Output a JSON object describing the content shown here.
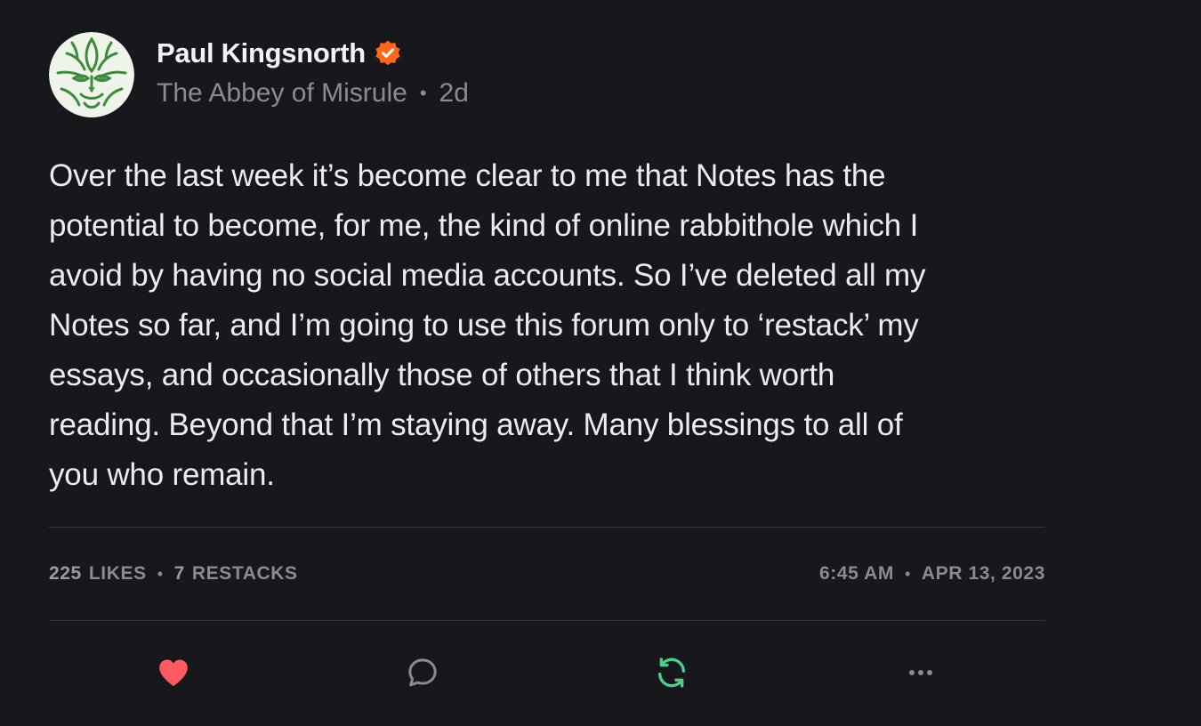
{
  "author": {
    "name": "Paul Kingsnorth",
    "publication": "The Abbey of Misrule",
    "age": "2d",
    "separator": "•"
  },
  "note": {
    "lines": [
      "Over the last week it’s become clear to me that Notes has the",
      "potential to become, for me, the kind of online rabbithole which I",
      "avoid by having no social media accounts. So I’ve deleted all my",
      "Notes so far, and I’m going to use this forum only to ‘restack’ my",
      "essays, and occasionally those of others that I think worth",
      "reading. Beyond that I’m staying away. Many blessings to all of",
      "you who remain."
    ]
  },
  "stats": {
    "likes_count": "225",
    "likes_label": "LIKES",
    "restacks_count": "7",
    "restacks_label": "RESTACKS",
    "time": "6:45 AM",
    "date": "APR 13, 2023",
    "separator": "•"
  },
  "icons": {
    "verified": "verified-badge-icon",
    "like": "heart-icon",
    "comment": "comment-icon",
    "restack": "restack-icon",
    "more": "more-icon"
  },
  "colors": {
    "background": "#18181c",
    "verified": "#ff6719",
    "like": "#ff5a5f",
    "restack": "#4ecf8f",
    "muted": "#8a8a93",
    "avatar_green": "#3e8a3c"
  }
}
